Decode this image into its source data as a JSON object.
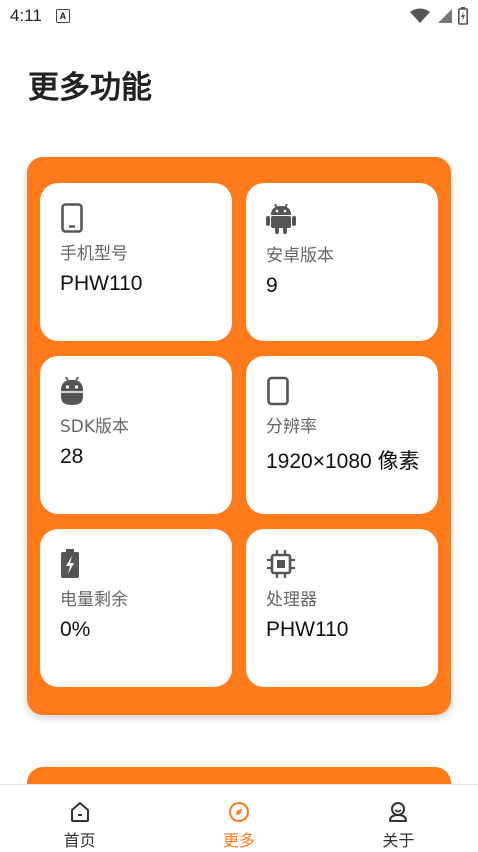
{
  "status_bar": {
    "time": "4:11",
    "app_icon_letter": "A"
  },
  "page": {
    "title": "更多功能"
  },
  "cards": [
    {
      "icon": "phone-icon",
      "label": "手机型号",
      "value": "PHW110"
    },
    {
      "icon": "android-icon",
      "label": "安卓版本",
      "value": "9"
    },
    {
      "icon": "android-head-icon",
      "label": "SDK版本",
      "value": "28"
    },
    {
      "icon": "screen-icon",
      "label": "分辨率",
      "value": "1920×1080 像素"
    },
    {
      "icon": "battery-charging-icon",
      "label": "电量剩余",
      "value": "0%"
    },
    {
      "icon": "processor-icon",
      "label": "处理器",
      "value": "PHW110"
    }
  ],
  "nav": {
    "items": [
      {
        "icon": "home-icon",
        "label": "首页",
        "active": false
      },
      {
        "icon": "compass-icon",
        "label": "更多",
        "active": true
      },
      {
        "icon": "person-icon",
        "label": "关于",
        "active": false
      }
    ]
  },
  "colors": {
    "accent": "#ff7a1a",
    "card_bg": "#ffffff",
    "text": "#111111",
    "label": "#666666"
  }
}
